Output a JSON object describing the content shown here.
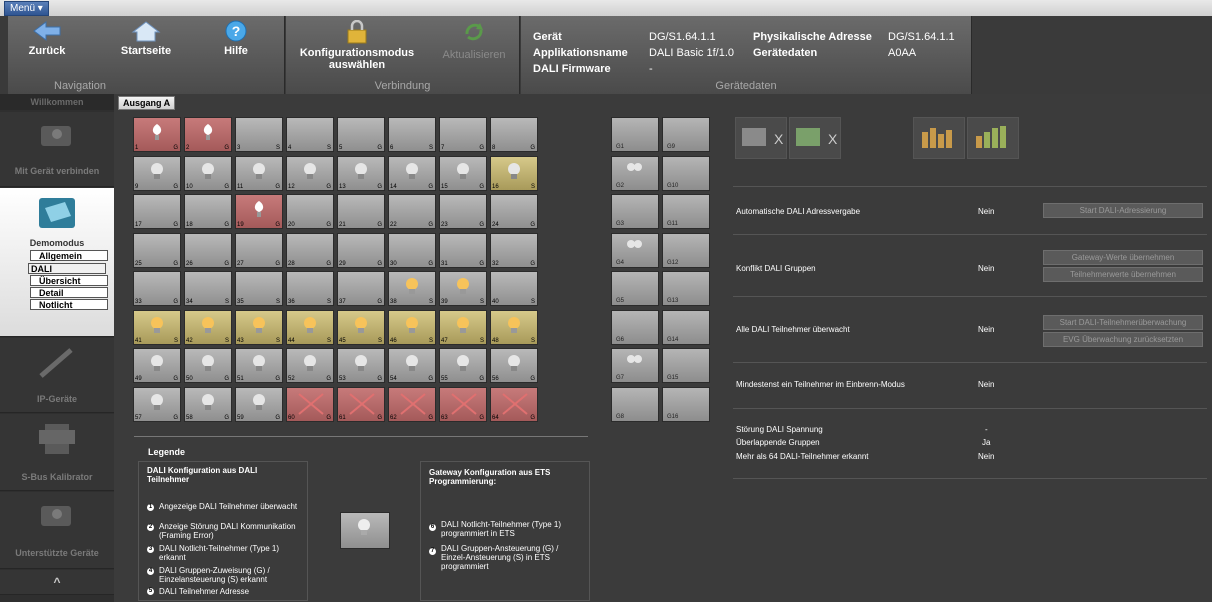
{
  "topbar": {
    "menu_label": "Menü ▾"
  },
  "ribbon": {
    "navigation": {
      "back": "Zurück",
      "home": "Startseite",
      "help": "Hilfe",
      "group_label": "Navigation"
    },
    "connection": {
      "config_mode": "Konfigurationsmodus auswählen",
      "update": "Aktualisieren",
      "group_label": "Verbindung"
    },
    "device": {
      "group_label": "Gerätedaten",
      "geraet_label": "Gerät",
      "geraet_value": "DG/S1.64.1.1",
      "phys_label": "Physikalische Adresse",
      "phys_value": "DG/S1.64.1.1",
      "app_label": "Applikationsname",
      "app_value": "DALI Basic 1f/1.0",
      "geraetedaten_label": "Gerätedaten",
      "geraetedaten_value": "A0AA",
      "firmware_label": "DALI Firmware",
      "firmware_value": "-"
    }
  },
  "sidebar": {
    "top": "Willkommen",
    "connect": "Mit Gerät verbinden",
    "demo": "Demomodus",
    "sub_allgemein": "Allgemein",
    "sub_dali": "DALI",
    "sub_uebersicht": "Übersicht",
    "sub_detail": "Detail",
    "sub_notlicht": "Notlicht",
    "ip": "IP-Geräte",
    "sbus": "S-Bus Kalibrator",
    "supported": "Unterstützte Geräte",
    "scroll_up": "^"
  },
  "tab_label": "Ausgang A",
  "grid": {
    "cells": [
      {
        "n": "1",
        "s": "G",
        "st": "red",
        "b": "w"
      },
      {
        "n": "2",
        "s": "G",
        "st": "red",
        "b": "w"
      },
      {
        "n": "3",
        "s": "S",
        "st": "grey",
        "b": ""
      },
      {
        "n": "4",
        "s": "S",
        "st": "grey",
        "b": ""
      },
      {
        "n": "5",
        "s": "G",
        "st": "grey",
        "b": ""
      },
      {
        "n": "6",
        "s": "S",
        "st": "grey",
        "b": ""
      },
      {
        "n": "7",
        "s": "G",
        "st": "grey",
        "b": ""
      },
      {
        "n": "8",
        "s": "G",
        "st": "grey",
        "b": ""
      },
      {
        "n": "9",
        "s": "G",
        "st": "grey",
        "b": "g"
      },
      {
        "n": "10",
        "s": "G",
        "st": "grey",
        "b": "g"
      },
      {
        "n": "11",
        "s": "G",
        "st": "grey",
        "b": "g"
      },
      {
        "n": "12",
        "s": "G",
        "st": "grey",
        "b": "g"
      },
      {
        "n": "13",
        "s": "G",
        "st": "grey",
        "b": "g"
      },
      {
        "n": "14",
        "s": "G",
        "st": "grey",
        "b": "g"
      },
      {
        "n": "15",
        "s": "G",
        "st": "grey",
        "b": "g"
      },
      {
        "n": "16",
        "s": "S",
        "st": "on",
        "b": "g"
      },
      {
        "n": "17",
        "s": "G",
        "st": "grey",
        "b": ""
      },
      {
        "n": "18",
        "s": "G",
        "st": "grey",
        "b": ""
      },
      {
        "n": "19",
        "s": "G",
        "st": "red",
        "b": "w"
      },
      {
        "n": "20",
        "s": "G",
        "st": "grey",
        "b": ""
      },
      {
        "n": "21",
        "s": "G",
        "st": "grey",
        "b": ""
      },
      {
        "n": "22",
        "s": "G",
        "st": "grey",
        "b": ""
      },
      {
        "n": "23",
        "s": "G",
        "st": "grey",
        "b": ""
      },
      {
        "n": "24",
        "s": "G",
        "st": "grey",
        "b": ""
      },
      {
        "n": "25",
        "s": "G",
        "st": "grey",
        "b": ""
      },
      {
        "n": "26",
        "s": "G",
        "st": "grey",
        "b": ""
      },
      {
        "n": "27",
        "s": "G",
        "st": "grey",
        "b": ""
      },
      {
        "n": "28",
        "s": "G",
        "st": "grey",
        "b": ""
      },
      {
        "n": "29",
        "s": "G",
        "st": "grey",
        "b": ""
      },
      {
        "n": "30",
        "s": "G",
        "st": "grey",
        "b": ""
      },
      {
        "n": "31",
        "s": "G",
        "st": "grey",
        "b": ""
      },
      {
        "n": "32",
        "s": "G",
        "st": "grey",
        "b": ""
      },
      {
        "n": "33",
        "s": "G",
        "st": "grey",
        "b": ""
      },
      {
        "n": "34",
        "s": "S",
        "st": "grey",
        "b": ""
      },
      {
        "n": "35",
        "s": "S",
        "st": "grey",
        "b": ""
      },
      {
        "n": "36",
        "s": "S",
        "st": "grey",
        "b": ""
      },
      {
        "n": "37",
        "s": "G",
        "st": "grey",
        "b": ""
      },
      {
        "n": "38",
        "s": "S",
        "st": "grey",
        "b": "y"
      },
      {
        "n": "39",
        "s": "S",
        "st": "grey",
        "b": "y"
      },
      {
        "n": "40",
        "s": "S",
        "st": "grey",
        "b": ""
      },
      {
        "n": "41",
        "s": "S",
        "st": "on",
        "b": "y"
      },
      {
        "n": "42",
        "s": "S",
        "st": "on",
        "b": "y"
      },
      {
        "n": "43",
        "s": "S",
        "st": "on",
        "b": "y"
      },
      {
        "n": "44",
        "s": "S",
        "st": "on",
        "b": "y"
      },
      {
        "n": "45",
        "s": "S",
        "st": "on",
        "b": "y"
      },
      {
        "n": "46",
        "s": "S",
        "st": "on",
        "b": "y"
      },
      {
        "n": "47",
        "s": "S",
        "st": "on",
        "b": "y"
      },
      {
        "n": "48",
        "s": "S",
        "st": "on",
        "b": "y"
      },
      {
        "n": "49",
        "s": "G",
        "st": "grey",
        "b": "g"
      },
      {
        "n": "50",
        "s": "G",
        "st": "grey",
        "b": "g"
      },
      {
        "n": "51",
        "s": "G",
        "st": "grey",
        "b": "g"
      },
      {
        "n": "52",
        "s": "G",
        "st": "grey",
        "b": "g"
      },
      {
        "n": "53",
        "s": "G",
        "st": "grey",
        "b": "g"
      },
      {
        "n": "54",
        "s": "G",
        "st": "grey",
        "b": "g"
      },
      {
        "n": "55",
        "s": "G",
        "st": "grey",
        "b": "g"
      },
      {
        "n": "56",
        "s": "G",
        "st": "grey",
        "b": "g"
      },
      {
        "n": "57",
        "s": "G",
        "st": "grey",
        "b": "g"
      },
      {
        "n": "58",
        "s": "G",
        "st": "grey",
        "b": "g"
      },
      {
        "n": "59",
        "s": "G",
        "st": "grey",
        "b": "g"
      },
      {
        "n": "60",
        "s": "G",
        "st": "red",
        "b": "x"
      },
      {
        "n": "61",
        "s": "G",
        "st": "red",
        "b": "x"
      },
      {
        "n": "62",
        "s": "G",
        "st": "red",
        "b": "x"
      },
      {
        "n": "63",
        "s": "G",
        "st": "red",
        "b": "x"
      },
      {
        "n": "64",
        "s": "G",
        "st": "red",
        "b": "x"
      }
    ]
  },
  "groups": [
    "G1",
    "G9",
    "G2",
    "G10",
    "G3",
    "G11",
    "G4",
    "G12",
    "G5",
    "G13",
    "G6",
    "G14",
    "G7",
    "G15",
    "G8",
    "G16"
  ],
  "legend": {
    "title": "Legende",
    "left_head": "DALI Konfiguration aus DALI Teilnehmer",
    "l1": "Angezeige DALI Teilnehmer überwacht",
    "l2": "Anzeige Störung DALI Kommunikation (Framing Error)",
    "l3": "DALI Notlicht-Teilnehmer (Type 1) erkannt",
    "l4": "DALI Gruppen-Zuweisung (G) / Einzelansteuerung (S) erkannt",
    "l5": "DALI Teilnehmer Adresse",
    "right_head": "Gateway Konfiguration aus ETS Programmierung:",
    "r6": "DALI Notlicht-Teilnehmer (Type 1) programmiert in ETS",
    "r7": "DALI Gruppen-Ansteuerung (G) / Einzel-Ansteuerung (S) in ETS programmiert"
  },
  "status": {
    "auto_label": "Automatische DALI Adressvergabe",
    "auto_value": "Nein",
    "auto_btn": "Start DALI-Adressierung",
    "konflikt_label": "Konflikt DALI Gruppen",
    "konflikt_value": "Nein",
    "gw_btn": "Gateway-Werte übernehmen",
    "tn_btn": "Teilnehmerwerte übernehmen",
    "watch_label": "Alle DALI Teilnehmer überwacht",
    "watch_value": "Nein",
    "watch_btn": "Start DALI-Teilnehmerüberwachung",
    "evg_btn": "EVG Überwachung zurücksetzten",
    "burn_label": "Mindestenst ein Teilnehmer im Einbrenn-Modus",
    "burn_value": "Nein",
    "spannung_label": "Störung DALI Spannung",
    "spannung_value": "-",
    "overlap_label": "Überlappende Gruppen",
    "overlap_value": "Ja",
    "mehr_label": "Mehr als 64 DALI-Teilnehmer erkannt",
    "mehr_value": "Nein"
  }
}
